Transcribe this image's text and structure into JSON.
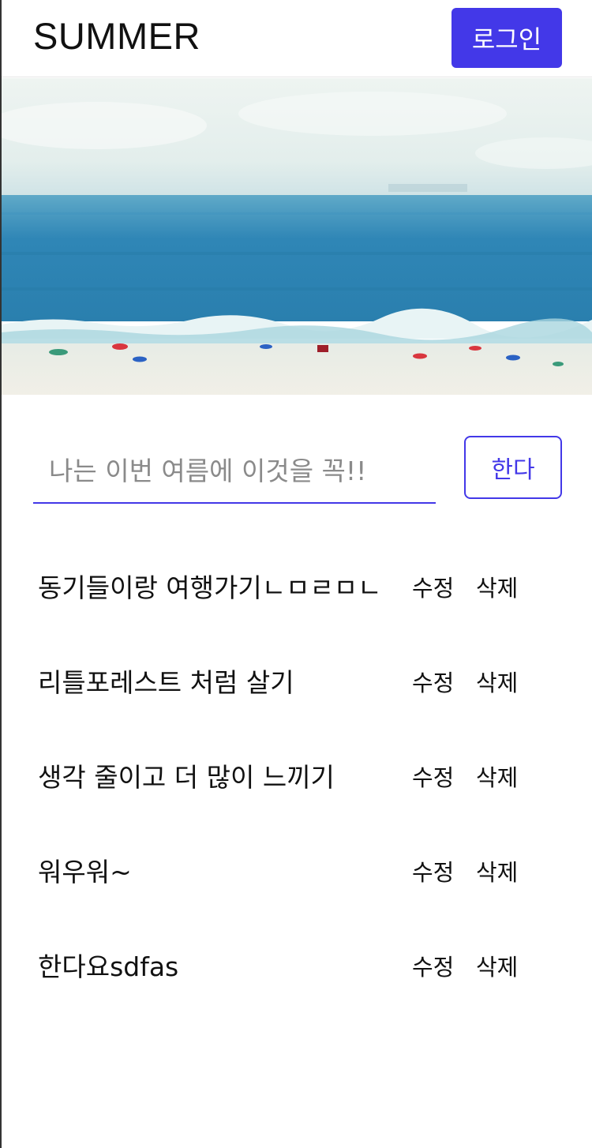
{
  "header": {
    "brand": "SUMMER",
    "login_label": "로그인"
  },
  "hero": {
    "image_subject": "beach-photo",
    "colors": {
      "sky": "#e9f1ef",
      "sea": "#2f86b6",
      "sand": "#efeee6"
    }
  },
  "form": {
    "placeholder": "나는 이번 여름에 이것을 꼭!!",
    "value": "",
    "submit_label": "한다"
  },
  "list": {
    "items": [
      {
        "text": "동기들이랑 여행가기ㄴㅁㄹㅁㄴ",
        "edit": "수정",
        "delete": "삭제"
      },
      {
        "text": "리틀포레스트 처럼 살기",
        "edit": "수정",
        "delete": "삭제"
      },
      {
        "text": "생각 줄이고 더 많이 느끼기",
        "edit": "수정",
        "delete": "삭제"
      },
      {
        "text": "워우워~",
        "edit": "수정",
        "delete": "삭제"
      },
      {
        "text": "한다요sdfas",
        "edit": "수정",
        "delete": "삭제"
      }
    ]
  },
  "theme": {
    "accent": "#4338e8"
  }
}
